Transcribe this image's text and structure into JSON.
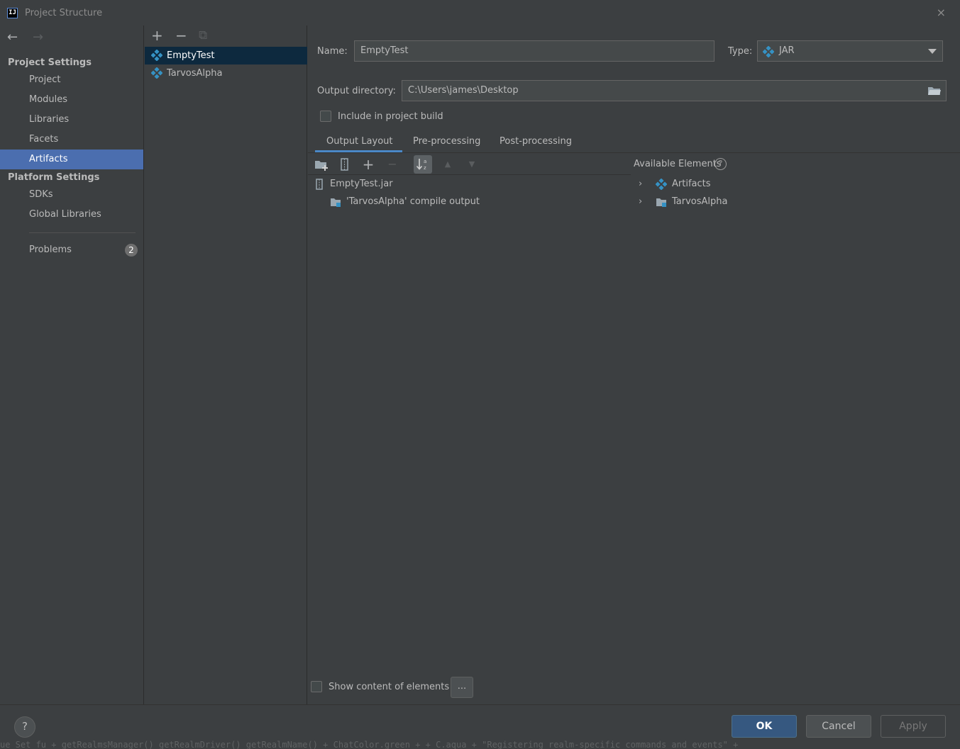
{
  "window": {
    "title": "Project Structure",
    "app_icon": "IJ",
    "close_icon": "×"
  },
  "nav": {
    "back_icon": "←",
    "forward_icon": "→",
    "project_settings_header": "Project Settings",
    "project_items": [
      "Project",
      "Modules",
      "Libraries",
      "Facets",
      "Artifacts"
    ],
    "selected": "Artifacts",
    "platform_settings_header": "Platform Settings",
    "platform_items": [
      "SDKs",
      "Global Libraries"
    ],
    "problems_label": "Problems",
    "problems_count": "2"
  },
  "artifacts_list": {
    "toolbar": {
      "add_icon": "+",
      "remove_icon": "−",
      "copy_icon": "⧉"
    },
    "items": [
      "EmptyTest",
      "TarvosAlpha"
    ],
    "selected": "EmptyTest"
  },
  "artifact_config": {
    "name_label": "Name:",
    "name_value": "EmptyTest",
    "type_label": "Type:",
    "type_value": "JAR",
    "output_dir_label": "Output directory:",
    "output_dir_value": "C:\\Users\\james\\Desktop",
    "include_in_build_label": "Include in project build",
    "include_in_build_checked": false,
    "tabs": [
      "Output Layout",
      "Pre-processing",
      "Post-processing"
    ],
    "active_tab": "Output Layout"
  },
  "output_layout": {
    "toolbar": {
      "new_directory_icon": "folder-plus",
      "archive_icon": "archive",
      "add_icon": "+",
      "remove_icon": "−",
      "sort_icon": "↓a z",
      "up_icon": "▲",
      "down_icon": "▼"
    },
    "tree": [
      {
        "label": "EmptyTest.jar",
        "icon": "jar-icon"
      },
      {
        "label": "'TarvosAlpha' compile output",
        "icon": "module-output-icon"
      }
    ],
    "available_elements_label": "Available Elements",
    "available_elements": [
      {
        "label": "Artifacts",
        "icon": "artifact-icon"
      },
      {
        "label": "TarvosAlpha",
        "icon": "module-folder-icon"
      }
    ],
    "show_content_label": "Show content of elements",
    "show_content_checked": false,
    "ellipsis_label": "..."
  },
  "footer": {
    "help_label": "?",
    "ok_label": "OK",
    "cancel_label": "Cancel",
    "apply_label": "Apply",
    "underlay_text": "ue Set fu     + getRealmsManager() getRealmDriver() getRealmName() + ChatColor.green +      + C.aqua + \"Registering realm-specific commands and events\"   +"
  },
  "colors": {
    "background": "#3c3f41",
    "selection": "#4b6eaf",
    "list_selection": "#0d293e",
    "accent_tab": "#4a88c7",
    "artifact_blue": "#3592c4",
    "ok_button": "#365880"
  }
}
